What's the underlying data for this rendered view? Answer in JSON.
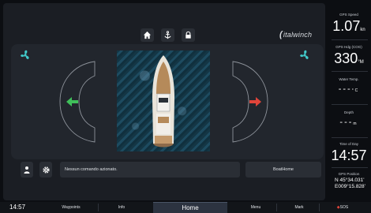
{
  "brand": {
    "name": "italwinch"
  },
  "status": {
    "message": "Nessun comando azionato.",
    "boat_home_label": "BoatHome"
  },
  "readouts": [
    {
      "label": "GPS Speed",
      "value": "1.07",
      "unit": "kn"
    },
    {
      "label": "GPS Hdg (COG)",
      "value": "330",
      "unit": "°M"
    },
    {
      "label": "Water Temp.",
      "value": "---",
      "unit": "°C"
    },
    {
      "label": "Depth",
      "value": "---",
      "unit": "m"
    },
    {
      "label": "Time of Day",
      "value": "14:57"
    }
  ],
  "gps_position": {
    "label": "GPS Position",
    "lat": "N 45°34.031'",
    "lon": "E009°15.828'"
  },
  "bottom_bar": {
    "time": "14:57",
    "tabs": [
      "Waypoints",
      "Info",
      "Home",
      "Menu",
      "Mark",
      "SOS"
    ]
  },
  "colors": {
    "left_arrow": "#3fbf5a",
    "right_arrow": "#e0443a",
    "fan": "#41c9c9",
    "sos": "#e0443a"
  },
  "icons": [
    "home-icon",
    "anchor-icon",
    "lock-icon",
    "fan-icon",
    "person-icon",
    "gear-icon",
    "sos-icon"
  ]
}
